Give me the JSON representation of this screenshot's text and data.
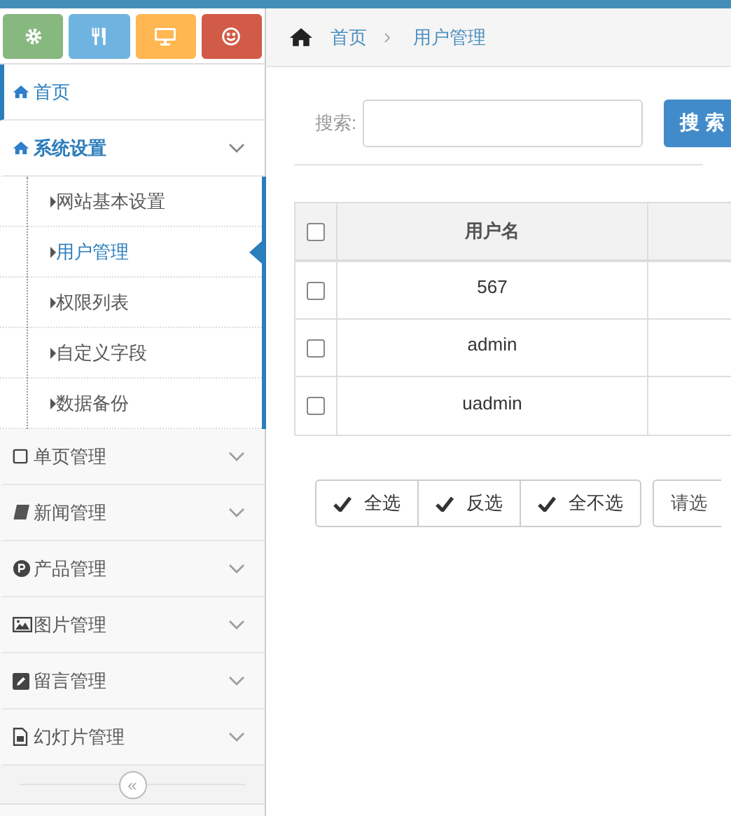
{
  "shortcuts": [
    {
      "kind": "gear",
      "color": "#87b87f"
    },
    {
      "kind": "cutlery",
      "color": "#6fb3e0"
    },
    {
      "kind": "desktop",
      "color": "#ffb752"
    },
    {
      "kind": "smile",
      "color": "#d15b47"
    }
  ],
  "menu": [
    {
      "label": "首页",
      "kind": "home",
      "selected": true
    },
    {
      "label": "系统设置",
      "kind": "home",
      "selected": false,
      "expanded": true,
      "children": [
        {
          "label": "网站基本设置",
          "selected": false
        },
        {
          "label": "用户管理",
          "selected": true
        },
        {
          "label": "权限列表",
          "selected": false
        },
        {
          "label": "自定义字段",
          "selected": false
        },
        {
          "label": "数据备份",
          "selected": false
        }
      ]
    },
    {
      "label": "单页管理",
      "kind": "square",
      "selected": false,
      "expanded": false
    },
    {
      "label": "新闻管理",
      "kind": "book",
      "selected": false,
      "expanded": false
    },
    {
      "label": "产品管理",
      "kind": "pcircle",
      "selected": false,
      "expanded": false
    },
    {
      "label": "图片管理",
      "kind": "picture",
      "selected": false,
      "expanded": false
    },
    {
      "label": "留言管理",
      "kind": "pencil",
      "selected": false,
      "expanded": false
    },
    {
      "label": "幻灯片管理",
      "kind": "file",
      "selected": false,
      "expanded": false
    }
  ],
  "collapse_button": "«",
  "breadcrumb": [
    "首页",
    "用户管理"
  ],
  "search": {
    "label": "搜索:",
    "button": "搜 索"
  },
  "table": {
    "columns": [
      "用户名"
    ],
    "header_checked": false,
    "rows": [
      {
        "checked": false,
        "username": "567"
      },
      {
        "checked": false,
        "username": "admin"
      },
      {
        "checked": false,
        "username": "uadmin"
      }
    ]
  },
  "buttons": [
    "全选",
    "反选",
    "全不选"
  ],
  "select": {
    "value": "请选"
  }
}
